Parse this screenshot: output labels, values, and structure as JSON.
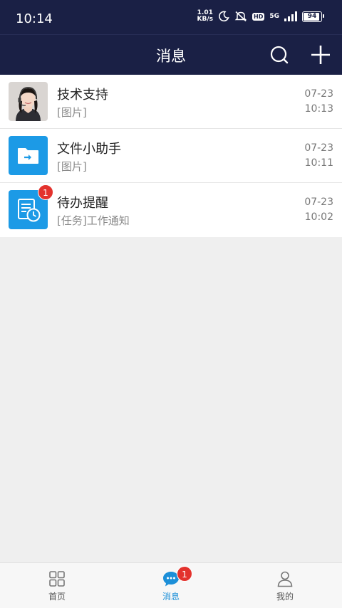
{
  "status_bar": {
    "time": "10:14",
    "net_speed_value": "1.01",
    "net_speed_unit": "KB/s",
    "hd": "HD",
    "network": "5G",
    "battery": "94",
    "battery_level": 0.94
  },
  "header": {
    "title": "消息"
  },
  "conversations": [
    {
      "name": "技术支持",
      "preview": "[图片]",
      "date": "07-23",
      "time": "10:13",
      "icon": "person-avatar"
    },
    {
      "name": "文件小助手",
      "preview": "[图片]",
      "date": "07-23",
      "time": "10:11",
      "icon": "folder-arrow-icon"
    },
    {
      "name": "待办提醒",
      "preview": "[任务]工作通知",
      "date": "07-23",
      "time": "10:02",
      "icon": "todo-clock-icon",
      "badge": "1"
    }
  ],
  "tabbar": {
    "home": "首页",
    "messages": "消息",
    "messages_badge": "1",
    "me": "我的"
  },
  "colors": {
    "header_bg": "#1a2045",
    "accent": "#1c8fd8",
    "badge": "#e3322d"
  }
}
